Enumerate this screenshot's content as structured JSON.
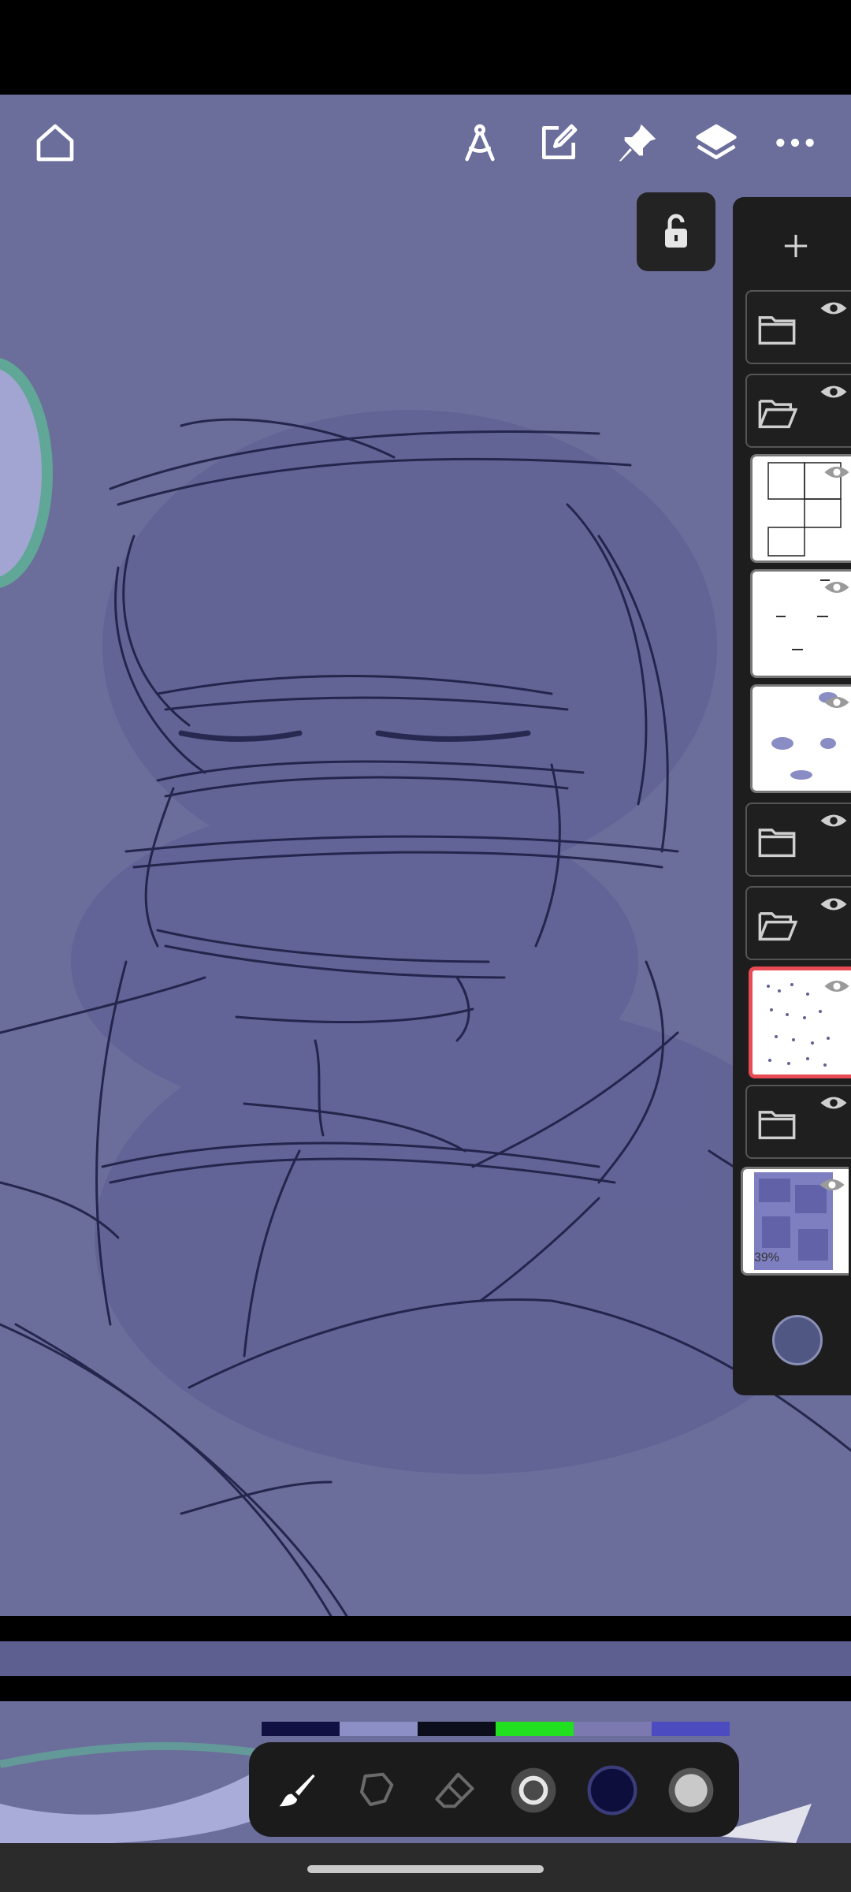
{
  "top_toolbar": {
    "icons": [
      "home-icon",
      "ruler-compass-icon",
      "edit-icon",
      "pin-icon",
      "layers-icon",
      "more-icon"
    ]
  },
  "lock_button": {
    "icon": "lock-open-icon"
  },
  "layers_panel": {
    "add_icon": "plus-icon",
    "background_opacity": "39%",
    "items": [
      {
        "type": "folder",
        "state": "closed",
        "visible": true
      },
      {
        "type": "folder",
        "state": "open",
        "visible": true
      },
      {
        "type": "layer",
        "content": "panels",
        "visible": true
      },
      {
        "type": "layer",
        "content": "text",
        "visible": true
      },
      {
        "type": "layer",
        "content": "speech",
        "visible": true
      },
      {
        "type": "folder",
        "state": "closed",
        "visible": true
      },
      {
        "type": "folder",
        "state": "open",
        "visible": true
      },
      {
        "type": "layer",
        "content": "sketch",
        "visible": true,
        "selected": true
      },
      {
        "type": "folder",
        "state": "closed",
        "visible": true
      },
      {
        "type": "layer",
        "content": "background",
        "visible": true
      }
    ]
  },
  "colors": {
    "canvas": "#6b6d9a",
    "stroke": "#1e1f45",
    "current_color": "#0e0e3d",
    "palette": [
      "#101043",
      "#8c8fc6",
      "#0d0e1c",
      "#20e020",
      "#7c78b0",
      "#4c4bc0"
    ]
  },
  "bottom_toolbar": {
    "tools": [
      "brush-icon",
      "lasso-icon",
      "eraser-icon",
      "brush-size-icon",
      "color-swatch-icon",
      "opacity-icon"
    ]
  }
}
